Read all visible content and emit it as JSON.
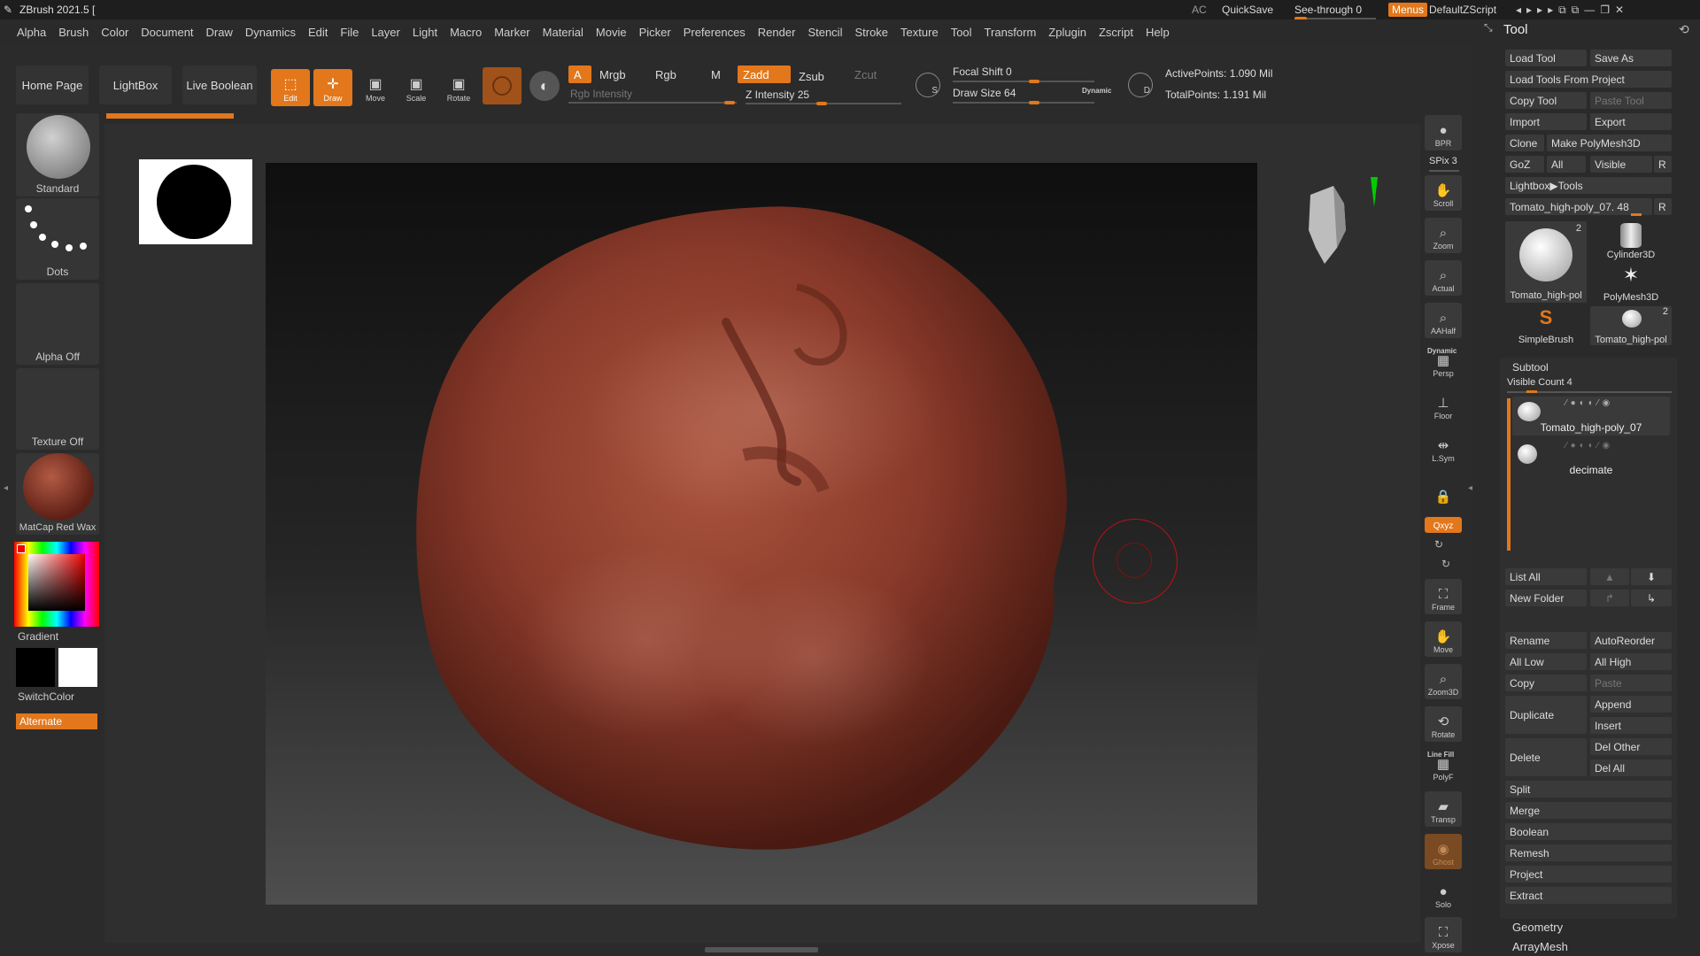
{
  "titlebar": {
    "title": "ZBrush 2021.5 [",
    "ac": "AC",
    "quicksave": "QuickSave",
    "see_through_label": "See-through",
    "see_through_value": "0",
    "menus": "Menus",
    "script": "DefaultZScript",
    "window_controls": [
      "◂▸▸",
      "▸▸",
      "⧉",
      "⧉",
      "—",
      "❐",
      "✕"
    ]
  },
  "menubar": [
    "Alpha",
    "Brush",
    "Color",
    "Document",
    "Draw",
    "Dynamics",
    "Edit",
    "File",
    "Layer",
    "Light",
    "Macro",
    "Marker",
    "Material",
    "Movie",
    "Picker",
    "Preferences",
    "Render",
    "Stencil",
    "Stroke",
    "Texture",
    "Tool",
    "Transform",
    "Zplugin",
    "Zscript",
    "Help"
  ],
  "shelf": {
    "home_page": "Home Page",
    "lightbox": "LightBox",
    "live_boolean": "Live Boolean",
    "tools": [
      {
        "label": "Edit",
        "icon": "edit-icon",
        "active": true
      },
      {
        "label": "Draw",
        "icon": "draw-icon",
        "active": true
      },
      {
        "label": "Move",
        "icon": "move-icon",
        "active": false
      },
      {
        "label": "Scale",
        "icon": "scale-icon",
        "active": false
      },
      {
        "label": "Rotate",
        "icon": "rotate-icon",
        "active": false
      }
    ],
    "modes": {
      "a": "A",
      "mrgb": "Mrgb",
      "rgb": "Rgb",
      "m": "M",
      "zadd": "Zadd",
      "zsub": "Zsub",
      "zcut": "Zcut",
      "rgb_intensity": "Rgb Intensity",
      "z_intensity": "Z Intensity 25"
    },
    "focal_shift": "Focal Shift 0",
    "draw_size": "Draw Size 64",
    "dynamic": "Dynamic",
    "active_points": "ActivePoints: 1.090 Mil",
    "total_points": "TotalPoints: 1.191 Mil",
    "s_label": "S",
    "d_label": "D"
  },
  "leftpanel": {
    "brush": "Standard",
    "stroke": "Dots",
    "alpha": "Alpha Off",
    "texture": "Texture Off",
    "material": "MatCap Red Wax",
    "gradient": "Gradient",
    "switchcolor": "SwitchColor",
    "alternate": "Alternate"
  },
  "rightstrip": [
    {
      "label": "BPR",
      "icon": "bpr-icon"
    },
    {
      "label": "SPix 3",
      "icon": ""
    },
    {
      "label": "Scroll",
      "icon": "scroll-icon"
    },
    {
      "label": "Zoom",
      "icon": "zoom-icon"
    },
    {
      "label": "Actual",
      "icon": "actual-icon"
    },
    {
      "label": "AAHalf",
      "icon": "aahalf-icon"
    },
    {
      "label": "Persp",
      "icon": "persp-icon"
    },
    {
      "label": "Floor",
      "icon": "floor-icon"
    },
    {
      "label": "L.Sym",
      "icon": "lsym-icon"
    },
    {
      "label": "",
      "icon": "lock-icon"
    },
    {
      "label": "Qxyz",
      "icon": "xyz-icon"
    },
    {
      "label": "Frame",
      "icon": "frame-icon"
    },
    {
      "label": "Move",
      "icon": "move-icon"
    },
    {
      "label": "Zoom3D",
      "icon": "zoom3d-icon"
    },
    {
      "label": "Rotate",
      "icon": "rotate-icon"
    },
    {
      "label": "PolyF",
      "icon": "polyf-icon"
    },
    {
      "label": "Transp",
      "icon": "transp-icon"
    },
    {
      "label": "Ghost",
      "icon": "ghost-icon"
    },
    {
      "label": "Solo",
      "icon": "solo-icon"
    },
    {
      "label": "Xpose",
      "icon": "xpose-icon"
    }
  ],
  "rightstrip_extra": {
    "dynamic": "Dynamic",
    "line_fill": "Line Fill"
  },
  "toolpalette": {
    "title": "Tool",
    "rows": [
      [
        "Load Tool",
        "Save As"
      ],
      [
        "Load Tools From Project",
        ""
      ],
      [
        "Copy Tool",
        "Paste Tool"
      ],
      [
        "Import",
        "Export"
      ],
      [
        "Clone",
        "Make PolyMesh3D"
      ],
      [
        "GoZ",
        "All",
        "Visible",
        "R"
      ]
    ],
    "lightbox_tools": "Lightbox▶Tools",
    "current_tool": "Tomato_high-poly_07. 48",
    "r": "R",
    "thumbs": [
      {
        "name": "Tomato_high-pol",
        "count": "2"
      },
      {
        "name": "Cylinder3D",
        "count": ""
      },
      {
        "name": "PolyMesh3D",
        "count": ""
      },
      {
        "name": "SimpleBrush",
        "count": ""
      },
      {
        "name": "Tomato_high-pol",
        "count": "2"
      }
    ],
    "subtool": {
      "title": "Subtool",
      "visible_count": "Visible Count 4",
      "items": [
        "Tomato_high-poly_07",
        "decimate"
      ],
      "list_all": "List All",
      "new_folder": "New Folder"
    },
    "actions": {
      "rename": "Rename",
      "autoreorder": "AutoReorder",
      "all_low": "All Low",
      "all_high": "All High",
      "copy": "Copy",
      "paste": "Paste",
      "duplicate": "Duplicate",
      "append": "Append",
      "insert": "Insert",
      "delete": "Delete",
      "del_other": "Del Other",
      "del_all": "Del All",
      "split": "Split",
      "merge": "Merge",
      "boolean": "Boolean",
      "remesh": "Remesh",
      "project": "Project",
      "extract": "Extract"
    },
    "sections": [
      "Geometry",
      "ArrayMesh"
    ]
  },
  "colors": {
    "accent": "#e2771b",
    "model": "#8e3b2c"
  }
}
